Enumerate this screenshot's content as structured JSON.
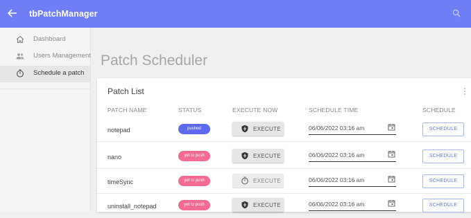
{
  "appbar": {
    "title": "tbPatchManager",
    "back_icon": "arrow-left-icon",
    "search_icon": "search-icon",
    "color": "#6f7ef5"
  },
  "sidebar": {
    "items": [
      {
        "label": "Dashboard",
        "icon": "home-icon",
        "active": false
      },
      {
        "label": "Users Management",
        "icon": "users-icon",
        "active": false
      },
      {
        "label": "Schedule a patch",
        "icon": "timer-icon",
        "active": true
      }
    ]
  },
  "page": {
    "title": "Patch Scheduler"
  },
  "card": {
    "title": "Patch List",
    "menu_icon": "more-vertical-icon",
    "columns": [
      "PATCH NAME",
      "STATUS",
      "EXECUTE NOW",
      "SCHEDULE TIME",
      "SCHEDULE"
    ]
  },
  "colors": {
    "pushed": "#5d6af0",
    "pending": "#f36a93",
    "schedule_outline": "#a9b7ee"
  },
  "rows": [
    {
      "name": "notepad",
      "status": "pushed",
      "execute_label": "EXECUTE",
      "execute_icon": "shield-icon",
      "schedule_time": "06/06/2022 03:16 am",
      "schedule_label": "SCHEDULE"
    },
    {
      "name": "nano",
      "status": "yet to push",
      "execute_label": "EXECUTE",
      "execute_icon": "shield-icon",
      "schedule_time": "06/06/2022 03:16 am",
      "schedule_label": "SCHEDULE"
    },
    {
      "name": "timeSync",
      "status": "yet to push",
      "execute_label": "EXECUTE",
      "execute_icon": "timer-icon",
      "schedule_time": "06/06/2022 03:16 am",
      "schedule_label": "SCHEDULE"
    },
    {
      "name": "uninstall_notepad",
      "status": "yet to push",
      "execute_label": "EXECUTE",
      "execute_icon": "shield-icon",
      "schedule_time": "06/06/2022 03:16 am",
      "schedule_label": "SCHEDULE"
    }
  ]
}
